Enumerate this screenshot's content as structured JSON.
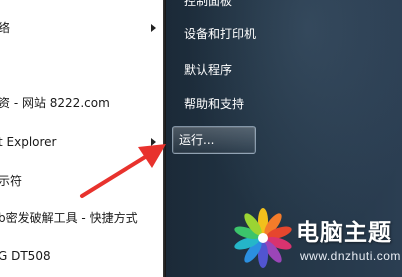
{
  "left_menu": {
    "items": [
      {
        "label": "络",
        "has_submenu": true
      },
      {
        "label": "资 - 网站 8222.com",
        "has_submenu": false
      },
      {
        "label": "t Explorer",
        "has_submenu": true
      },
      {
        "label": "示符",
        "has_submenu": false
      },
      {
        "label": "b密发破解工具 - 快捷方式",
        "has_submenu": false
      },
      {
        "label": "G DT508",
        "has_submenu": false
      }
    ]
  },
  "right_menu": {
    "partial_top": "控制面板",
    "items": [
      "设备和打印机",
      "默认程序",
      "帮助和支持"
    ],
    "run": "运行..."
  },
  "watermark": {
    "title": "电脑主题",
    "url": "www.dnzhuti.com"
  },
  "colors": {
    "arrow": "#e8322d",
    "right_pane": "#223444",
    "watermark_title": "#ffffff"
  },
  "annotation": {
    "type": "red arrow pointing at run item",
    "icon": "arrow-icon"
  }
}
